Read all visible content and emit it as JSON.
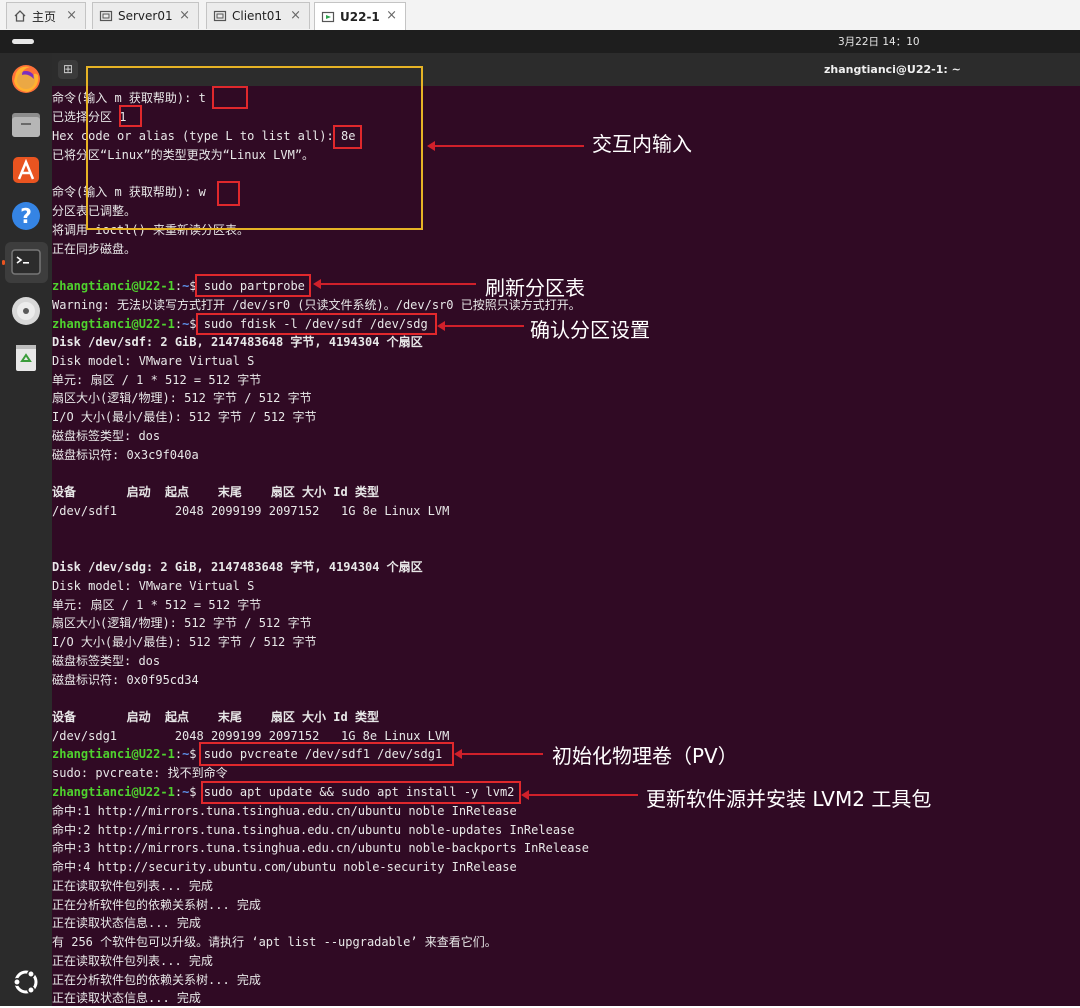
{
  "tabs": [
    {
      "label": "主页",
      "icon": "home-icon"
    },
    {
      "label": "Server01",
      "icon": "vm-icon"
    },
    {
      "label": "Client01",
      "icon": "vm-icon"
    },
    {
      "label": "U22-1",
      "icon": "vm-running-icon",
      "active": true
    }
  ],
  "tab_close_glyph": "×",
  "topbar": {
    "clock": "3月22日  14：10"
  },
  "dock": [
    "firefox-icon",
    "files-icon",
    "app-center-icon",
    "help-icon",
    "terminal-icon",
    "optical-disc-icon",
    "trash-icon",
    "ubuntu-logo-icon"
  ],
  "terminal": {
    "title": "zhangtianci@U22-1: ~",
    "new_tab_glyph": "⊞",
    "prompt_user": "zhangtianci@U22-1",
    "prompt_sep": ":",
    "prompt_path": "~",
    "prompt_dollar": "$ ",
    "lines": {
      "l1": "命令(输入 m 获取帮助): t",
      "l2": "已选择分区 1",
      "l3": "Hex code or alias (type L to list all): 8e",
      "l4": "已将分区“Linux”的类型更改为“Linux LVM”。",
      "l6": "命令(输入 m 获取帮助): w",
      "l7": "分区表已调整。",
      "l8": "将调用 ioctl() 来重新读分区表。",
      "l9": "正在同步磁盘。",
      "cmd1": "sudo partprobe",
      "l12": "Warning: 无法以读写方式打开 /dev/sr0 (只读文件系统)。/dev/sr0 已按照只读方式打开。",
      "cmd2": "sudo fdisk -l /dev/sdf /dev/sdg",
      "l14": "Disk /dev/sdf: 2 GiB, 2147483648 字节, 4194304 个扇区",
      "l15": "Disk model: VMware Virtual S",
      "l16": "单元: 扇区 / 1 * 512 = 512 字节",
      "l17": "扇区大小(逻辑/物理): 512 字节 / 512 字节",
      "l18": "I/O 大小(最小/最佳): 512 字节 / 512 字节",
      "l19": "磁盘标签类型: dos",
      "l20": "磁盘标识符: 0x3c9f040a",
      "l22": "设备       启动  起点    末尾    扇区 大小 Id 类型",
      "l23": "/dev/sdf1        2048 2099199 2097152   1G 8e Linux LVM",
      "l26": "Disk /dev/sdg: 2 GiB, 2147483648 字节, 4194304 个扇区",
      "l27": "Disk model: VMware Virtual S",
      "l28": "单元: 扇区 / 1 * 512 = 512 字节",
      "l29": "扇区大小(逻辑/物理): 512 字节 / 512 字节",
      "l30": "I/O 大小(最小/最佳): 512 字节 / 512 字节",
      "l31": "磁盘标签类型: dos",
      "l32": "磁盘标识符: 0x0f95cd34",
      "l34": "设备       启动  起点    末尾    扇区 大小 Id 类型",
      "l35": "/dev/sdg1        2048 2099199 2097152   1G 8e Linux LVM",
      "cmd3": "sudo pvcreate /dev/sdf1 /dev/sdg1",
      "l37": "sudo: pvcreate: 找不到命令",
      "cmd4": "sudo apt update && sudo apt install -y lvm2",
      "l39": "命中:1 http://mirrors.tuna.tsinghua.edu.cn/ubuntu noble InRelease",
      "l40": "命中:2 http://mirrors.tuna.tsinghua.edu.cn/ubuntu noble-updates InRelease",
      "l41": "命中:3 http://mirrors.tuna.tsinghua.edu.cn/ubuntu noble-backports InRelease",
      "l42": "命中:4 http://security.ubuntu.com/ubuntu noble-security InRelease",
      "l43": "正在读取软件包列表... 完成",
      "l44": "正在分析软件包的依赖关系树... 完成",
      "l45": "正在读取状态信息... 完成",
      "l46": "有 256 个软件包可以升级。请执行 ‘apt list --upgradable’ 来查看它们。",
      "l47": "正在读取软件包列表... 完成",
      "l48": "正在分析软件包的依赖关系树... 完成",
      "l49": "正在读取状态信息... 完成"
    }
  },
  "annotations": {
    "interactive": "交互内输入",
    "refresh": "刷新分区表",
    "confirm": "确认分区设置",
    "init_pv": "初始化物理卷（PV）",
    "install": "更新软件源并安装 LVM2 工具包"
  },
  "colors": {
    "terminal_bg": "#300a24",
    "prompt_user": "#4fd22e",
    "prompt_path": "#5c8fe6",
    "annotation_box": "#e0282c",
    "highlight_box": "#e6b325"
  }
}
